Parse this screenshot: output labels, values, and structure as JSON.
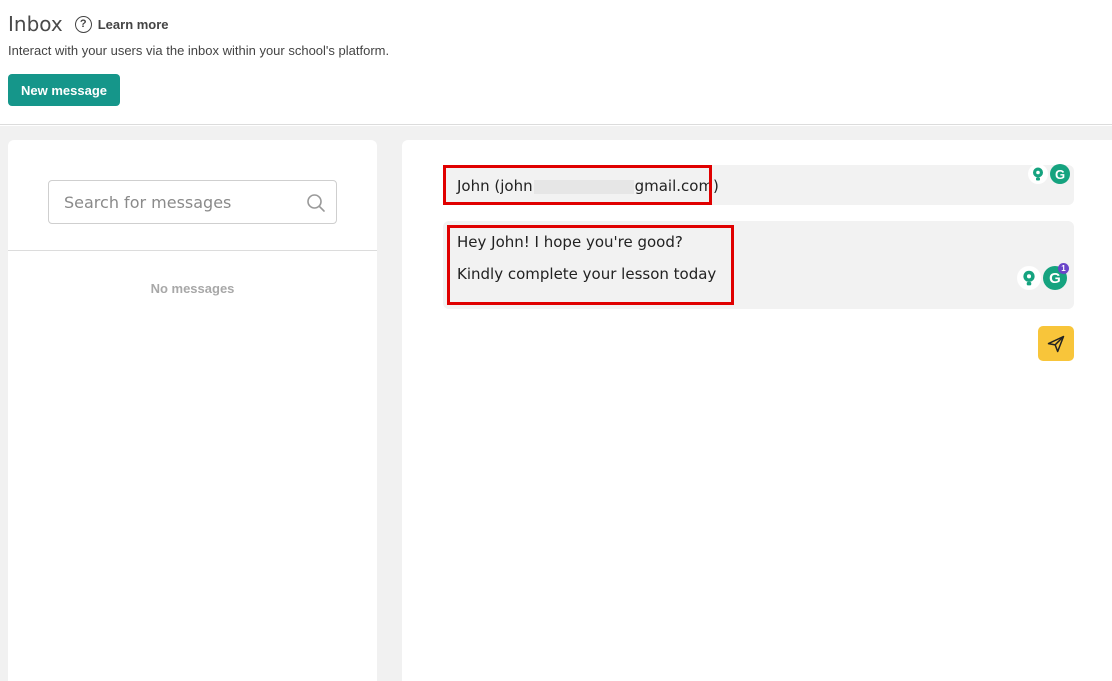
{
  "header": {
    "title": "Inbox",
    "help_icon_glyph": "?",
    "learn_more": "Learn more",
    "subtitle": "Interact with your users via the inbox within your school's platform.",
    "new_message_label": "New message"
  },
  "sidebar": {
    "search_placeholder": "Search for messages",
    "empty_text": "No messages"
  },
  "composer": {
    "recipient_prefix": "John (john",
    "recipient_suffix": "gmail.com)",
    "message_lines": [
      "Hey John! I hope you're good?",
      "Kindly complete your lesson today"
    ],
    "grammarly_badge": "1"
  },
  "colors": {
    "brand_button": "#15968a",
    "send_button": "#f8c53a",
    "highlight": "#e00000",
    "grammarly_green": "#15a37f"
  },
  "icons": [
    "help-icon",
    "search-icon",
    "bulb-icon",
    "grammarly-icon",
    "send-icon"
  ]
}
